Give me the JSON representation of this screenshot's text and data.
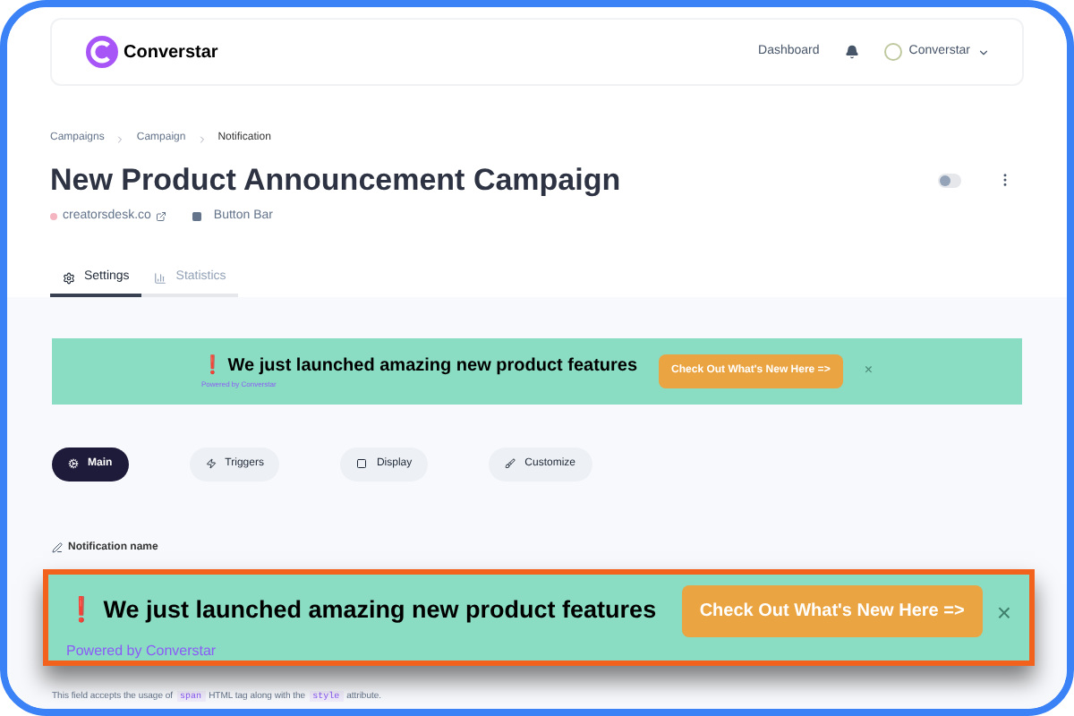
{
  "header": {
    "brand": "Converstar",
    "nav_link": "Dashboard",
    "account": "Converstar"
  },
  "breadcrumbs": [
    "Campaigns",
    "Campaign",
    "Notification"
  ],
  "title": "New Product Announcement Campaign",
  "toggle": {
    "on": false
  },
  "meta": [
    {
      "kind": "site",
      "text": "creatorsdesk.co"
    },
    {
      "kind": "type",
      "text": "Button Bar"
    }
  ],
  "tabs": [
    {
      "label": "Settings",
      "selected": true
    },
    {
      "label": "Statistics",
      "selected": false
    }
  ],
  "preview_banner": {
    "mark": "❗",
    "message": "We just launched amazing new product features",
    "powered_by": "Powered by Converstar",
    "button": "Check Out What's New Here =>",
    "close": "×"
  },
  "sections": [
    {
      "label": "Main",
      "selected": true
    },
    {
      "label": "Triggers",
      "selected": false
    },
    {
      "label": "Display",
      "selected": false
    },
    {
      "label": "Customize",
      "selected": false
    }
  ],
  "field": {
    "label": "Notification name",
    "hint": [
      {
        "kind": "text",
        "text": "This field accepts the usage of"
      },
      {
        "kind": "code",
        "text": "span"
      },
      {
        "kind": "text",
        "text": "HTML tag along with the"
      },
      {
        "kind": "code",
        "text": "style"
      },
      {
        "kind": "text",
        "text": "attribute."
      }
    ]
  },
  "zoomed_banner": {
    "mark": "❗",
    "message": "We just launched amazing new product features",
    "powered_by": "Powered by Converstar",
    "button": "Check Out What's New Here =>",
    "close": "×"
  }
}
